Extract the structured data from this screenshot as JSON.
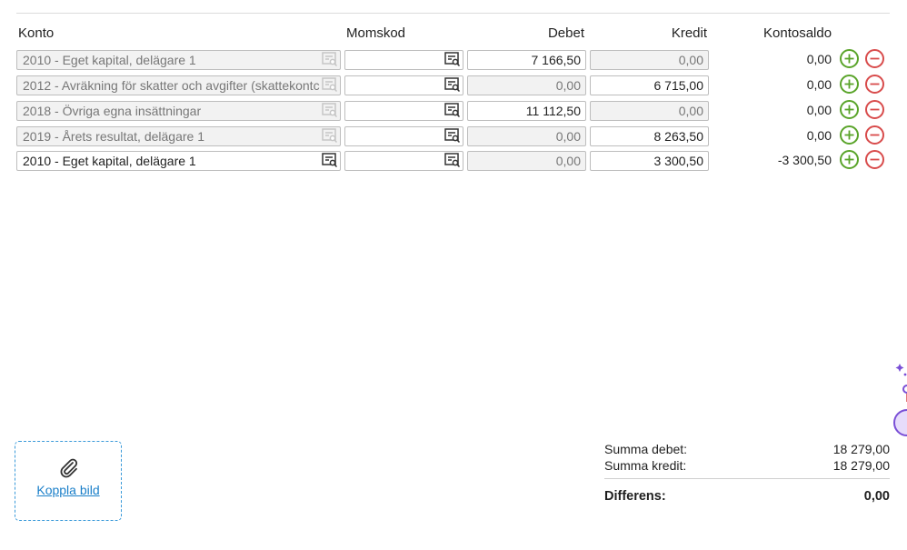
{
  "headers": {
    "konto": "Konto",
    "momskod": "Momskod",
    "debet": "Debet",
    "kredit": "Kredit",
    "kontosaldo": "Kontosaldo"
  },
  "rows": [
    {
      "konto": "2010 - Eget kapital, delägare 1",
      "momskod": "",
      "debet": "7 166,50",
      "kredit": "0,00",
      "saldo": "0,00"
    },
    {
      "konto": "2012 - Avräkning för skatter och avgifter (skattekontc",
      "momskod": "",
      "debet": "0,00",
      "kredit": "6 715,00",
      "saldo": "0,00"
    },
    {
      "konto": "2018 - Övriga egna insättningar",
      "momskod": "",
      "debet": "11 112,50",
      "kredit": "0,00",
      "saldo": "0,00"
    },
    {
      "konto": "2019 - Årets resultat, delägare 1",
      "momskod": "",
      "debet": "0,00",
      "kredit": "8 263,50",
      "saldo": "0,00"
    },
    {
      "konto": "2010 - Eget kapital, delägare 1",
      "momskod": "",
      "debet": "0,00",
      "kredit": "3 300,50",
      "saldo": "-3 300,50"
    }
  ],
  "attach": {
    "label": "Koppla bild"
  },
  "summary": {
    "debet_label": "Summa debet:",
    "debet_value": "18 279,00",
    "kredit_label": "Summa kredit:",
    "kredit_value": "18 279,00",
    "diff_label": "Differens:",
    "diff_value": "0,00"
  },
  "icons": {
    "lookup": "search-list-icon",
    "add": "plus-circle-icon",
    "remove": "minus-circle-icon",
    "attach": "paperclip-icon"
  },
  "colors": {
    "add": "#5aa42a",
    "remove": "#d84b4b",
    "link": "#1a7fc9",
    "dashed_border": "#3a9ad9"
  }
}
